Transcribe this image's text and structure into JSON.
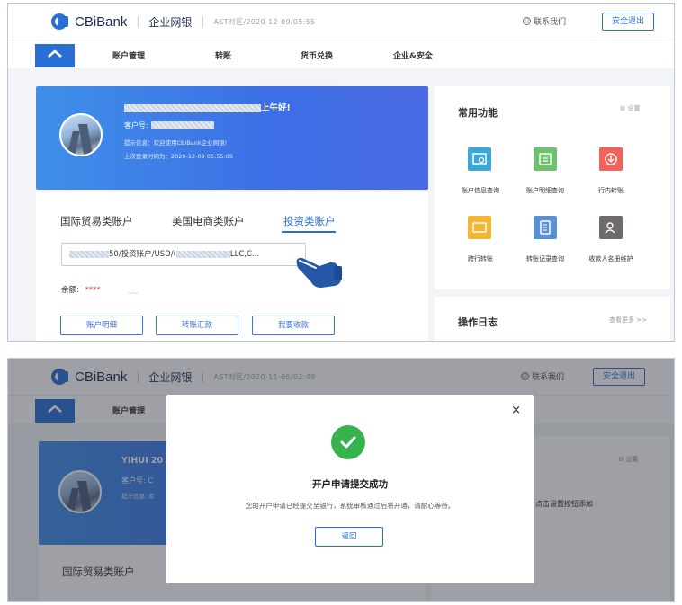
{
  "colors": {
    "brand": "#2a6fd6",
    "success": "#37b24d",
    "pointer": "#2557a8"
  },
  "top": {
    "header": {
      "brand": "CBiBank",
      "separator": "|",
      "product": "企业网银",
      "server_info": "AST时区/2020-12-09/05:55",
      "contact_label": "联系我们",
      "logout_label": "安全退出"
    },
    "nav": {
      "home_icon": "home-icon",
      "items": [
        "账户管理",
        "转账",
        "货币兑换",
        "企业&安全"
      ]
    },
    "welcome": {
      "greeting": "上午好!",
      "customer_label": "客户号:",
      "tip_line": "提示信息：欢迎使用CBiBank企业网银!",
      "last_login": "上次登录时间为：2020-12-09 05:55:05"
    },
    "account_tabs": [
      "国际贸易类账户",
      "美国电商类账户",
      "投资类账户"
    ],
    "active_tab": 2,
    "account": {
      "select_middle": "50/投资账户/USD/(",
      "select_end": "LLC,C..."
    },
    "balance": {
      "label": "余额:",
      "value": "****"
    },
    "actions": [
      "账户明细",
      "转账汇款",
      "我要收款"
    ],
    "functions": {
      "title": "常用功能",
      "settings_label": "设置",
      "items": [
        {
          "label": "账户信息查询",
          "color": "#3da6d9",
          "icon": "card-search-icon"
        },
        {
          "label": "账户明细查询",
          "color": "#6fc06f",
          "icon": "statement-icon"
        },
        {
          "label": "行内转账",
          "color": "#f0625a",
          "icon": "transfer-icon"
        },
        {
          "label": "跨行转账",
          "color": "#f2b632",
          "icon": "folder-icon"
        },
        {
          "label": "转账记录查询",
          "color": "#5a8fd6",
          "icon": "record-icon"
        },
        {
          "label": "收款人名册维护",
          "color": "#6f6a6a",
          "icon": "contacts-icon"
        }
      ]
    },
    "log": {
      "title": "操作日志",
      "more_label": "查看更多 >>"
    }
  },
  "bottom": {
    "header": {
      "brand": "CBiBank",
      "separator": "|",
      "product": "企业网银",
      "server_info": "AST时区/2020-11-05/02:49",
      "contact_label": "联系我们",
      "logout_label": "安全退出"
    },
    "nav": {
      "first_item": "账户管理"
    },
    "welcome": {
      "greeting": "YIHUI 20",
      "customer_label": "客户号: C",
      "tip_line": "提示信息: 欢"
    },
    "account_tab": "国际贸易类账户",
    "settings_label": "设置",
    "hint_text": "点击设置按钮添加",
    "modal": {
      "close": "×",
      "title": "开户申请提交成功",
      "message": "您的开户申请已经提交至银行，系统审核通过后将开通，请耐心等待。",
      "button": "返回"
    }
  }
}
